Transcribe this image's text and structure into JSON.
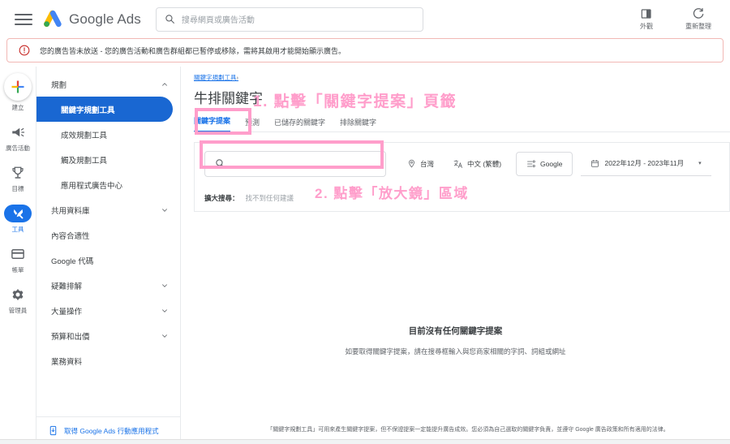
{
  "topbar": {
    "menu_icon": "hamburger-icon",
    "brand_google": "Google",
    "brand_ads": "Ads",
    "search_placeholder": "搜尋網頁或廣告活動",
    "search_value": "",
    "actions": [
      {
        "icon": "appearance-icon",
        "label": "外觀"
      },
      {
        "icon": "refresh-icon",
        "label": "重新整理"
      }
    ]
  },
  "alert": {
    "icon": "error-circle-icon",
    "text": "您的廣告皆未放送 - 您的廣告活動和廣告群組都已暫停或移除，需將其啟用才能開始顯示廣告。",
    "border_color": "#f2b8b5"
  },
  "rail": {
    "items": [
      {
        "icon": "plus-fab-icon",
        "label": "建立",
        "active": false
      },
      {
        "icon": "megaphone-icon",
        "label": "廣告活動",
        "active": false
      },
      {
        "icon": "trophy-icon",
        "label": "目標",
        "active": false
      },
      {
        "icon": "tools-icon",
        "label": "工具",
        "active": true
      },
      {
        "icon": "billing-card-icon",
        "label": "帳單",
        "active": false
      },
      {
        "icon": "gear-icon",
        "label": "管理員",
        "active": false
      }
    ],
    "active_color": "#1a73e8"
  },
  "sidenav": {
    "items": [
      {
        "label": "規劃",
        "type": "group",
        "expanded": true,
        "caret": "chevron-up-icon"
      },
      {
        "label": "關鍵字規劃工具",
        "type": "sub",
        "selected": true
      },
      {
        "label": "成效規劃工具",
        "type": "sub",
        "selected": false
      },
      {
        "label": "觸及規劃工具",
        "type": "sub",
        "selected": false
      },
      {
        "label": "應用程式廣告中心",
        "type": "sub",
        "selected": false
      },
      {
        "label": "共用資料庫",
        "type": "group",
        "expanded": false,
        "caret": "chevron-down-icon"
      },
      {
        "label": "內容合適性",
        "type": "item"
      },
      {
        "label": "Google 代碼",
        "type": "item"
      },
      {
        "label": "疑難排解",
        "type": "group",
        "expanded": false,
        "caret": "chevron-down-icon"
      },
      {
        "label": "大量操作",
        "type": "group",
        "expanded": false,
        "caret": "chevron-down-icon"
      },
      {
        "label": "預算和出價",
        "type": "group",
        "expanded": false,
        "caret": "chevron-down-icon"
      },
      {
        "label": "業務資料",
        "type": "item"
      }
    ],
    "promo": {
      "icon": "mobile-phone-icon",
      "label": "取得 Google Ads 行動應用程式"
    },
    "selected_bg": "#1967d2"
  },
  "main": {
    "breadcrumb": "關鍵字規劃工具",
    "breadcrumb_chevron": "›",
    "page_title": "牛排關鍵字",
    "tabs": [
      {
        "label": "關鍵字提案",
        "active": true
      },
      {
        "label": "預測",
        "active": false
      },
      {
        "label": "已儲存的關鍵字",
        "active": false
      },
      {
        "label": "排除關鍵字",
        "active": false
      }
    ],
    "keyword_input": {
      "icon": "search-icon",
      "value": "",
      "placeholder": ""
    },
    "filters": [
      {
        "icon": "location-pin-icon",
        "label": "台灣",
        "boxed": false
      },
      {
        "icon": "translate-icon",
        "label": "中文 (繁體)",
        "boxed": false
      },
      {
        "icon": "network-icon",
        "label": "Google",
        "boxed": true
      }
    ],
    "date_range": {
      "icon": "calendar-icon",
      "label": "2022年12月 - 2023年11月",
      "arrow": "▾"
    },
    "expand_search": {
      "label": "擴大搜尋：",
      "value": "找不到任何建議"
    },
    "empty_state": {
      "title": "目前沒有任何關鍵字提案",
      "subtitle": "如要取得關鍵字提案，請在搜尋框輸入與您商家相關的字詞、詞組或網址"
    },
    "footer_note": "「關鍵字規劃工具」可用來產生關鍵字提案，但不保證提案一定能提升廣告成效。您必須為自己選取的關鍵字負責，並遵守 Google 廣告政策和所有適用的法律。"
  },
  "annotations": {
    "color": "#ff9ecb",
    "step1_text": "1. 點擊「關鍵字提案」頁籤",
    "step2_text": "2. 點擊「放大鏡」區域"
  }
}
